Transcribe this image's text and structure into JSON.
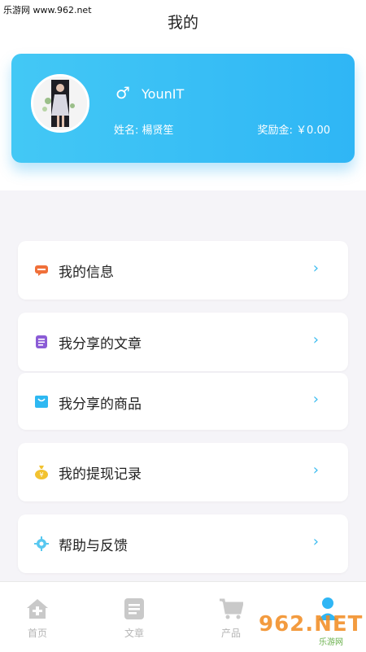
{
  "watermark": {
    "top": "乐游网 www.962.net",
    "bottom": "962.NET",
    "bottom_sub": "乐游网"
  },
  "header": {
    "title": "我的"
  },
  "profile": {
    "gender_symbol": "♂",
    "username": "YounIT",
    "name_label": "姓名: 楊贤笙",
    "reward_label": "奖励金: ￥0.00"
  },
  "menu": [
    {
      "label": "我的信息",
      "icon": "message-icon",
      "color": "#f0703a"
    },
    {
      "label": "我分享的文章",
      "icon": "article-icon",
      "color": "#8b5cd6"
    },
    {
      "label": "我分享的商品",
      "icon": "bag-icon",
      "color": "#2eb8f2"
    },
    {
      "label": "我的提现记录",
      "icon": "money-bag-icon",
      "color": "#f2c230"
    },
    {
      "label": "帮助与反馈",
      "icon": "gear-icon",
      "color": "#58c8f0"
    }
  ],
  "nav": [
    {
      "label": "首页",
      "icon": "home-icon"
    },
    {
      "label": "文章",
      "icon": "article-icon"
    },
    {
      "label": "产品",
      "icon": "cart-icon"
    },
    {
      "label": "我的",
      "icon": "user-icon",
      "active": true
    }
  ],
  "colors": {
    "accent": "#2fb6f5",
    "card_start": "#43c8f5"
  }
}
